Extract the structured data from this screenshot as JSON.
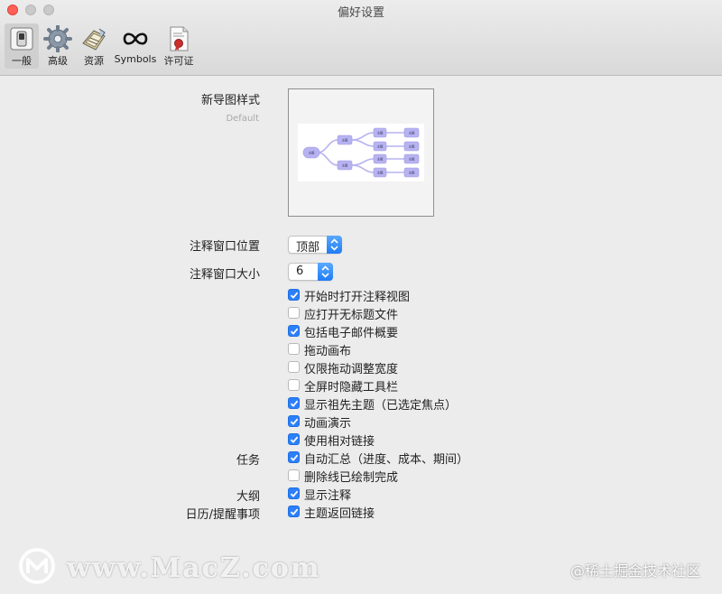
{
  "window": {
    "title": "偏好设置"
  },
  "toolbar": {
    "items": [
      {
        "label": "一般",
        "icon": "switch-icon",
        "selected": true
      },
      {
        "label": "高级",
        "icon": "gear-icon",
        "selected": false
      },
      {
        "label": "资源",
        "icon": "resources-icon",
        "selected": false
      },
      {
        "label": "Symbols",
        "icon": "infinity-icon",
        "selected": false
      },
      {
        "label": "许可证",
        "icon": "certificate-icon",
        "selected": false
      }
    ]
  },
  "map_style": {
    "label": "新导图样式",
    "value": "Default",
    "preview_node_label": "主题"
  },
  "note_position": {
    "label": "注释窗口位置",
    "value": "顶部"
  },
  "note_size": {
    "label": "注释窗口大小",
    "value": "6"
  },
  "options": [
    {
      "label": "开始时打开注释视图",
      "checked": true
    },
    {
      "label": "应打开无标题文件",
      "checked": false
    },
    {
      "label": "包括电子邮件概要",
      "checked": true
    },
    {
      "label": "拖动画布",
      "checked": false
    },
    {
      "label": "仅限拖动调整宽度",
      "checked": false
    },
    {
      "label": "全屏时隐藏工具栏",
      "checked": false
    },
    {
      "label": "显示祖先主题（已选定焦点）",
      "checked": true
    },
    {
      "label": "动画演示",
      "checked": true
    },
    {
      "label": "使用相对链接",
      "checked": true
    }
  ],
  "tasks": {
    "label": "任务",
    "options": [
      {
        "label": "自动汇总（进度、成本、期间）",
        "checked": true
      },
      {
        "label": "删除线已绘制完成",
        "checked": false
      }
    ]
  },
  "outline": {
    "label": "大纲",
    "options": [
      {
        "label": "显示注释",
        "checked": true
      }
    ]
  },
  "calendar": {
    "label": "日历/提醒事项",
    "options": [
      {
        "label": "主题返回链接",
        "checked": true
      }
    ]
  },
  "watermark": {
    "left_text": "www.MacZ.com",
    "right_text": "@稀土掘金技术社区"
  },
  "colors": {
    "accent": "#2d7ff7",
    "node_fill": "#b7b3f0",
    "traffic_red": "#ff5f57"
  }
}
